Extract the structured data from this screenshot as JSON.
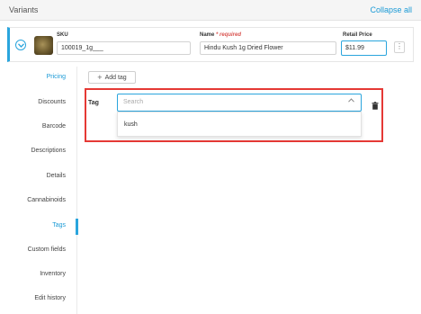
{
  "header": {
    "title": "Variants",
    "collapse_all": "Collapse all"
  },
  "variant": {
    "sku_label": "SKU",
    "sku_value": "100019_1g___",
    "name_label": "Name",
    "name_required": "* required",
    "name_value": "Hindu Kush 1g Dried Flower",
    "price_label": "Retail Price",
    "price_value": "$11.99",
    "more": "⋮"
  },
  "sidebar": {
    "items": [
      {
        "label": "Pricing",
        "active": false
      },
      {
        "label": "Discounts",
        "active": false
      },
      {
        "label": "Barcode",
        "active": false
      },
      {
        "label": "Descriptions",
        "active": false
      },
      {
        "label": "Details",
        "active": false
      },
      {
        "label": "Cannabinoids",
        "active": false
      },
      {
        "label": "Tags",
        "active": true
      },
      {
        "label": "Custom fields",
        "active": false
      },
      {
        "label": "Inventory",
        "active": false
      },
      {
        "label": "Edit history",
        "active": false
      }
    ]
  },
  "tags": {
    "add_button": "Add tag",
    "add_icon": "+",
    "field_label": "Tag",
    "search_placeholder": "Search",
    "caret": "^",
    "option": "kush"
  },
  "colors": {
    "accent": "#2aa5dd",
    "highlight_border": "#e53935",
    "required": "#d9534f"
  }
}
